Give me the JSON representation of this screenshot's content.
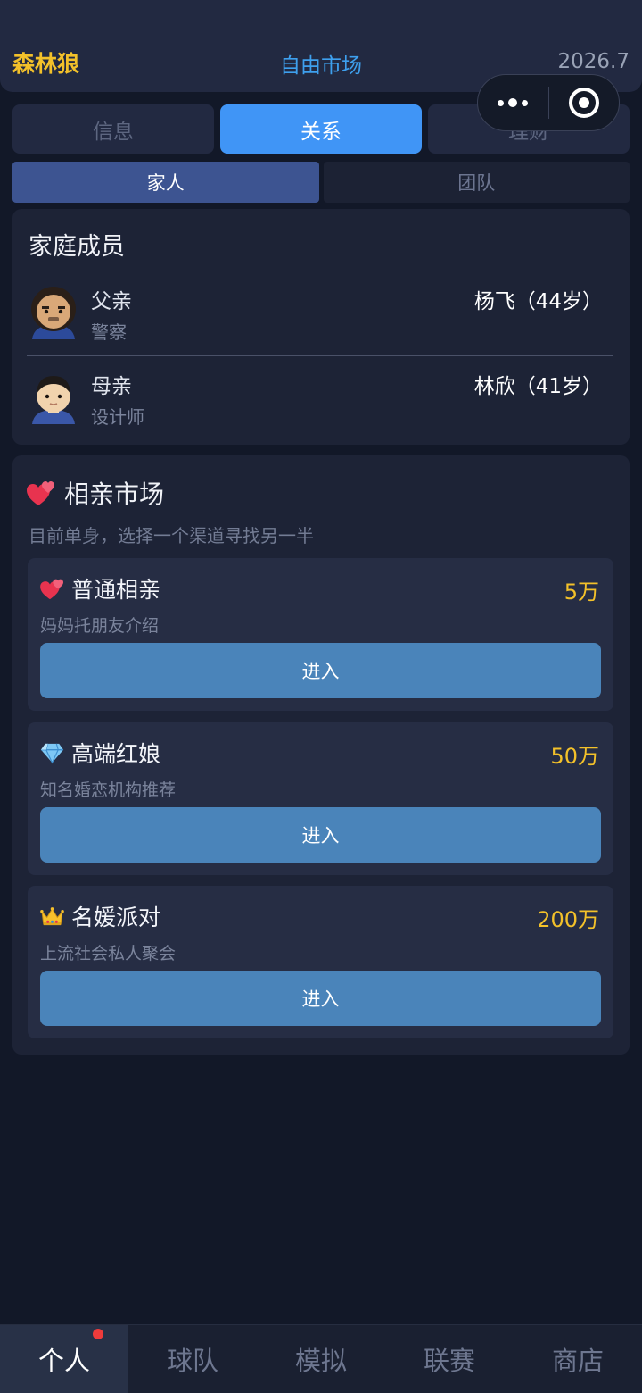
{
  "header": {
    "user": "森林狼",
    "title": "自由市场",
    "date": "2026.7"
  },
  "tabs": [
    {
      "label": "信息",
      "active": false
    },
    {
      "label": "关系",
      "active": true
    },
    {
      "label": "理财",
      "active": false
    }
  ],
  "subtabs": [
    {
      "label": "家人",
      "active": true
    },
    {
      "label": "团队",
      "active": false
    }
  ],
  "family": {
    "title": "家庭成员",
    "members": [
      {
        "role": "父亲",
        "job": "警察",
        "name": "杨飞（44岁）",
        "avatar": "father-avatar-icon"
      },
      {
        "role": "母亲",
        "job": "设计师",
        "name": "林欣（41岁）",
        "avatar": "mother-avatar-icon"
      }
    ]
  },
  "market": {
    "title": "相亲市场",
    "title_icon": "two-hearts-icon",
    "subtitle": "目前单身，选择一个渠道寻找另一半",
    "options": [
      {
        "name": "普通相亲",
        "desc": "妈妈托朋友介绍",
        "price": "5万",
        "button": "进入",
        "icon": "two-hearts-icon"
      },
      {
        "name": "高端红娘",
        "desc": "知名婚恋机构推荐",
        "price": "50万",
        "button": "进入",
        "icon": "diamond-icon"
      },
      {
        "name": "名媛派对",
        "desc": "上流社会私人聚会",
        "price": "200万",
        "button": "进入",
        "icon": "crown-icon"
      }
    ]
  },
  "bottom_nav": [
    {
      "label": "个人",
      "active": true,
      "badge": true
    },
    {
      "label": "球队",
      "active": false
    },
    {
      "label": "模拟",
      "active": false
    },
    {
      "label": "联赛",
      "active": false
    },
    {
      "label": "商店",
      "active": false
    }
  ],
  "colors": {
    "accent_blue": "#4095f6",
    "gold": "#f3c12a",
    "button_blue": "#4a84ba",
    "badge_red": "#ef3b3b",
    "background": "#121828"
  }
}
